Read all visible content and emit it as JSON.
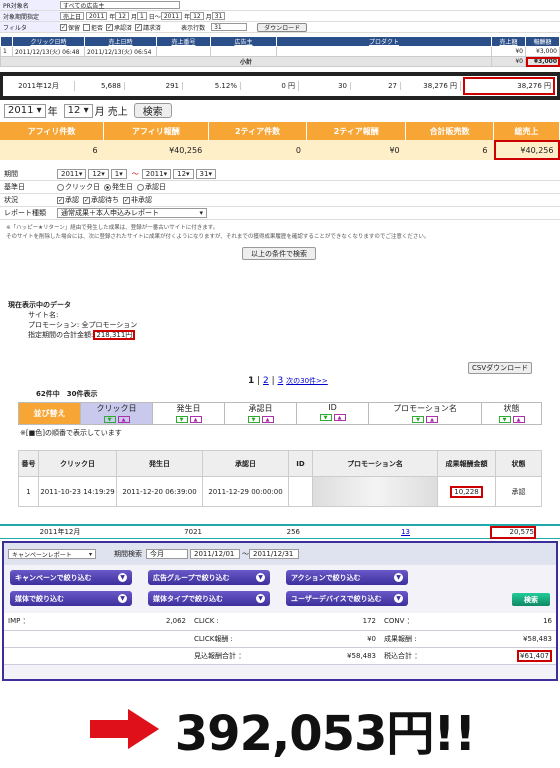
{
  "p1": {
    "filters": [
      {
        "label": "PR対象名",
        "values": [
          "すべての広告主"
        ]
      },
      {
        "label": "対象期間指定",
        "values": [
          "売上日",
          "2011",
          "年",
          "12",
          "月",
          "1",
          "日〜",
          "2011",
          "年",
          "12",
          "月",
          "31"
        ]
      },
      {
        "label": "フィルタ",
        "values": [
          "保留",
          "拒否",
          "承認済",
          "請求済",
          "表示行数",
          "31"
        ]
      }
    ],
    "download_label": "ダウンロード",
    "headers": [
      "",
      "クリック日時",
      "売上日時",
      "売上番号",
      "広告主",
      "プロダクト",
      "売上額",
      "報酬額"
    ],
    "row": [
      "1",
      "2011/12/13(火) 06:48",
      "2011/12/13(火) 06:54",
      "",
      "",
      "",
      "¥0",
      "¥3,000"
    ],
    "subtotal_label": "小計",
    "subtotal_values": [
      "¥0",
      "¥3,000"
    ]
  },
  "p1b": {
    "cells": [
      "2011年12月",
      "5,688",
      "291",
      "5.12%",
      "0 円",
      "30",
      "27",
      "38,276 円",
      "38,276 円"
    ]
  },
  "p2": {
    "year": "2011",
    "year_suffix": "年",
    "month": "12",
    "month_suffix": "月 売上",
    "search": "検索",
    "headers": [
      "アフィリ件数",
      "アフィリ報酬",
      "2ティア件数",
      "2ティア報酬",
      "合計販売数",
      "総売上"
    ],
    "values": [
      "6",
      "¥40,256",
      "0",
      "¥0",
      "6",
      "¥40,256"
    ]
  },
  "p3": {
    "period_label": "期間",
    "period": [
      "2011",
      "12",
      "1",
      "〜",
      "2011",
      "12",
      "31"
    ],
    "basis_label": "基準日",
    "basis": [
      "クリック日",
      "発生日",
      "承認日"
    ],
    "status_label": "状況",
    "status": [
      "承認",
      "承認待ち",
      "非承認"
    ],
    "report_label": "レポート種類",
    "report": "通常成果＋本人申込みレポート",
    "note1": "※「ハッピー★リターン」経由で発生した成果は、登録が一番古いサイトに付きます。",
    "note2": "そのサイトを削除した場合には、次に登録されたサイトに成果が付くようになりますが、それまでの獲得成果履歴を確認することができなくなりますのでご注意ください。",
    "submit": "以上の条件で検索"
  },
  "p4": {
    "title": "現在表示中のデータ",
    "site": "サイト名:",
    "promo": "プロモーション: 全プロモーション",
    "total_label": "指定期間の合計金額:",
    "total": "218,311円",
    "csv": "CSVダウンロード",
    "pages": [
      "1",
      "2",
      "3",
      "次の30件>>"
    ],
    "count": "62件中　30件表示",
    "sort_label": "並び替え",
    "sort_cols": [
      "クリック日",
      "発生日",
      "承認日",
      "ID",
      "プロモーション名",
      "状態"
    ],
    "legend": "※[■色]の順番で表示しています",
    "headers": [
      "番号",
      "クリック日",
      "発生日",
      "承認日",
      "ID",
      "プロモーション名",
      "成果報酬金額",
      "状態"
    ],
    "row": [
      "1",
      "2011-10-23 14:19:29",
      "2011-12-20 06:39:00",
      "2011-12-29 00:00:00",
      "",
      "",
      "10,228",
      "承認"
    ]
  },
  "p4b": {
    "cells": [
      "2011年12月",
      "7021",
      "256",
      "13",
      "20,575"
    ]
  },
  "p5": {
    "campaign": "キャンペーンレポート",
    "period_label": "期間検索",
    "period_sel": "今月",
    "from": "2011/12/01",
    "tilde": "〜",
    "to": "2011/12/31",
    "filters": [
      "キャンペーンで絞り込む",
      "広告グループで絞り込む",
      "アクションで絞り込む",
      "媒体で絞り込む",
      "媒体タイプで絞り込む",
      "ユーザーデバイスで絞り込む"
    ],
    "search": "検索",
    "stats": [
      [
        "IMP ：",
        "2,062",
        "CLICK :",
        "172",
        "CONV ：",
        "16"
      ],
      [
        "",
        "",
        "CLICK報酬 :",
        "¥0",
        "成果報酬 :",
        "¥58,483"
      ],
      [
        "",
        "",
        "見込報酬合計 ：",
        "¥58,483",
        "税込合計 ：",
        "¥61,407"
      ]
    ]
  },
  "banner": {
    "amount": "392,053円!!"
  },
  "colors": {
    "accent_red": "#c00000",
    "orange": "#f7a535",
    "navy": "#2b4f88",
    "purple": "#3c2f9c"
  }
}
